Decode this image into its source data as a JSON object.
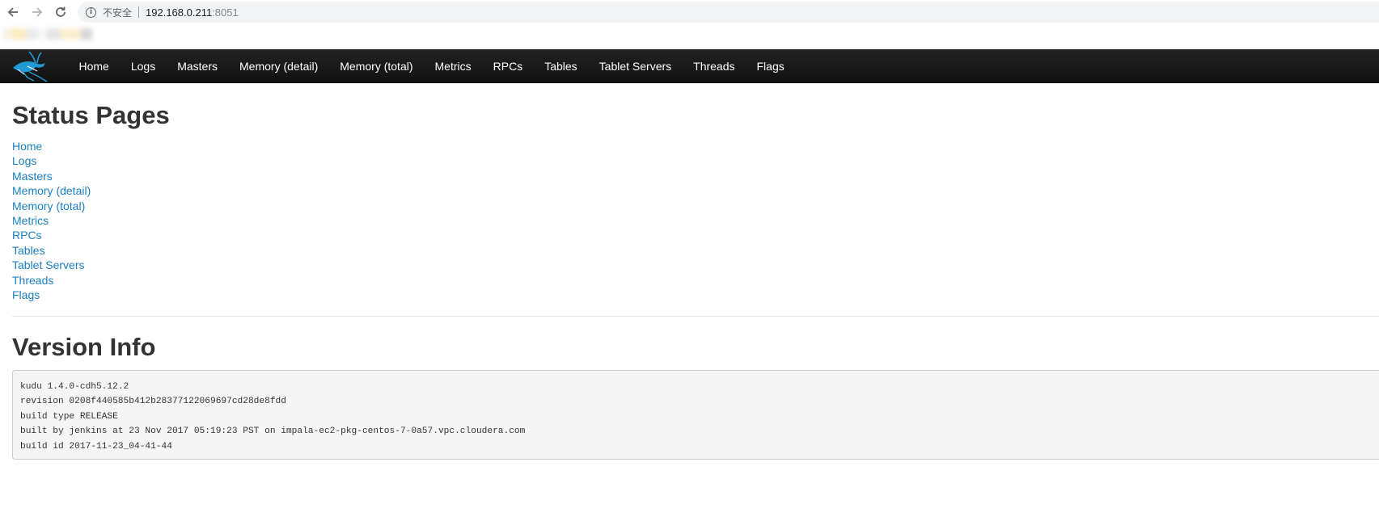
{
  "browser": {
    "security_label": "不安全",
    "url_host": "192.168.0.211",
    "url_port": ":8051"
  },
  "navbar": {
    "logo_icon": "kudu-antelope-logo",
    "items": [
      "Home",
      "Logs",
      "Masters",
      "Memory (detail)",
      "Memory (total)",
      "Metrics",
      "RPCs",
      "Tables",
      "Tablet Servers",
      "Threads",
      "Flags"
    ]
  },
  "status_pages": {
    "title": "Status Pages",
    "links": [
      "Home",
      "Logs",
      "Masters",
      "Memory (detail)",
      "Memory (total)",
      "Metrics",
      "RPCs",
      "Tables",
      "Tablet Servers",
      "Threads",
      "Flags"
    ]
  },
  "version_info": {
    "title": "Version Info",
    "lines": [
      "kudu 1.4.0-cdh5.12.2",
      "revision 0208f440585b412b28377122069697cd28de8fdd",
      "build type RELEASE",
      "built by jenkins at 23 Nov 2017 05:19:23 PST on impala-ec2-pkg-centos-7-0a57.vpc.cloudera.com",
      "build id 2017-11-23_04-41-44"
    ]
  },
  "colors": {
    "navbar_bg": "#1b1b1b",
    "link": "#1a7fc1",
    "heading": "#333333",
    "logo_blue": "#1f9ad6"
  }
}
